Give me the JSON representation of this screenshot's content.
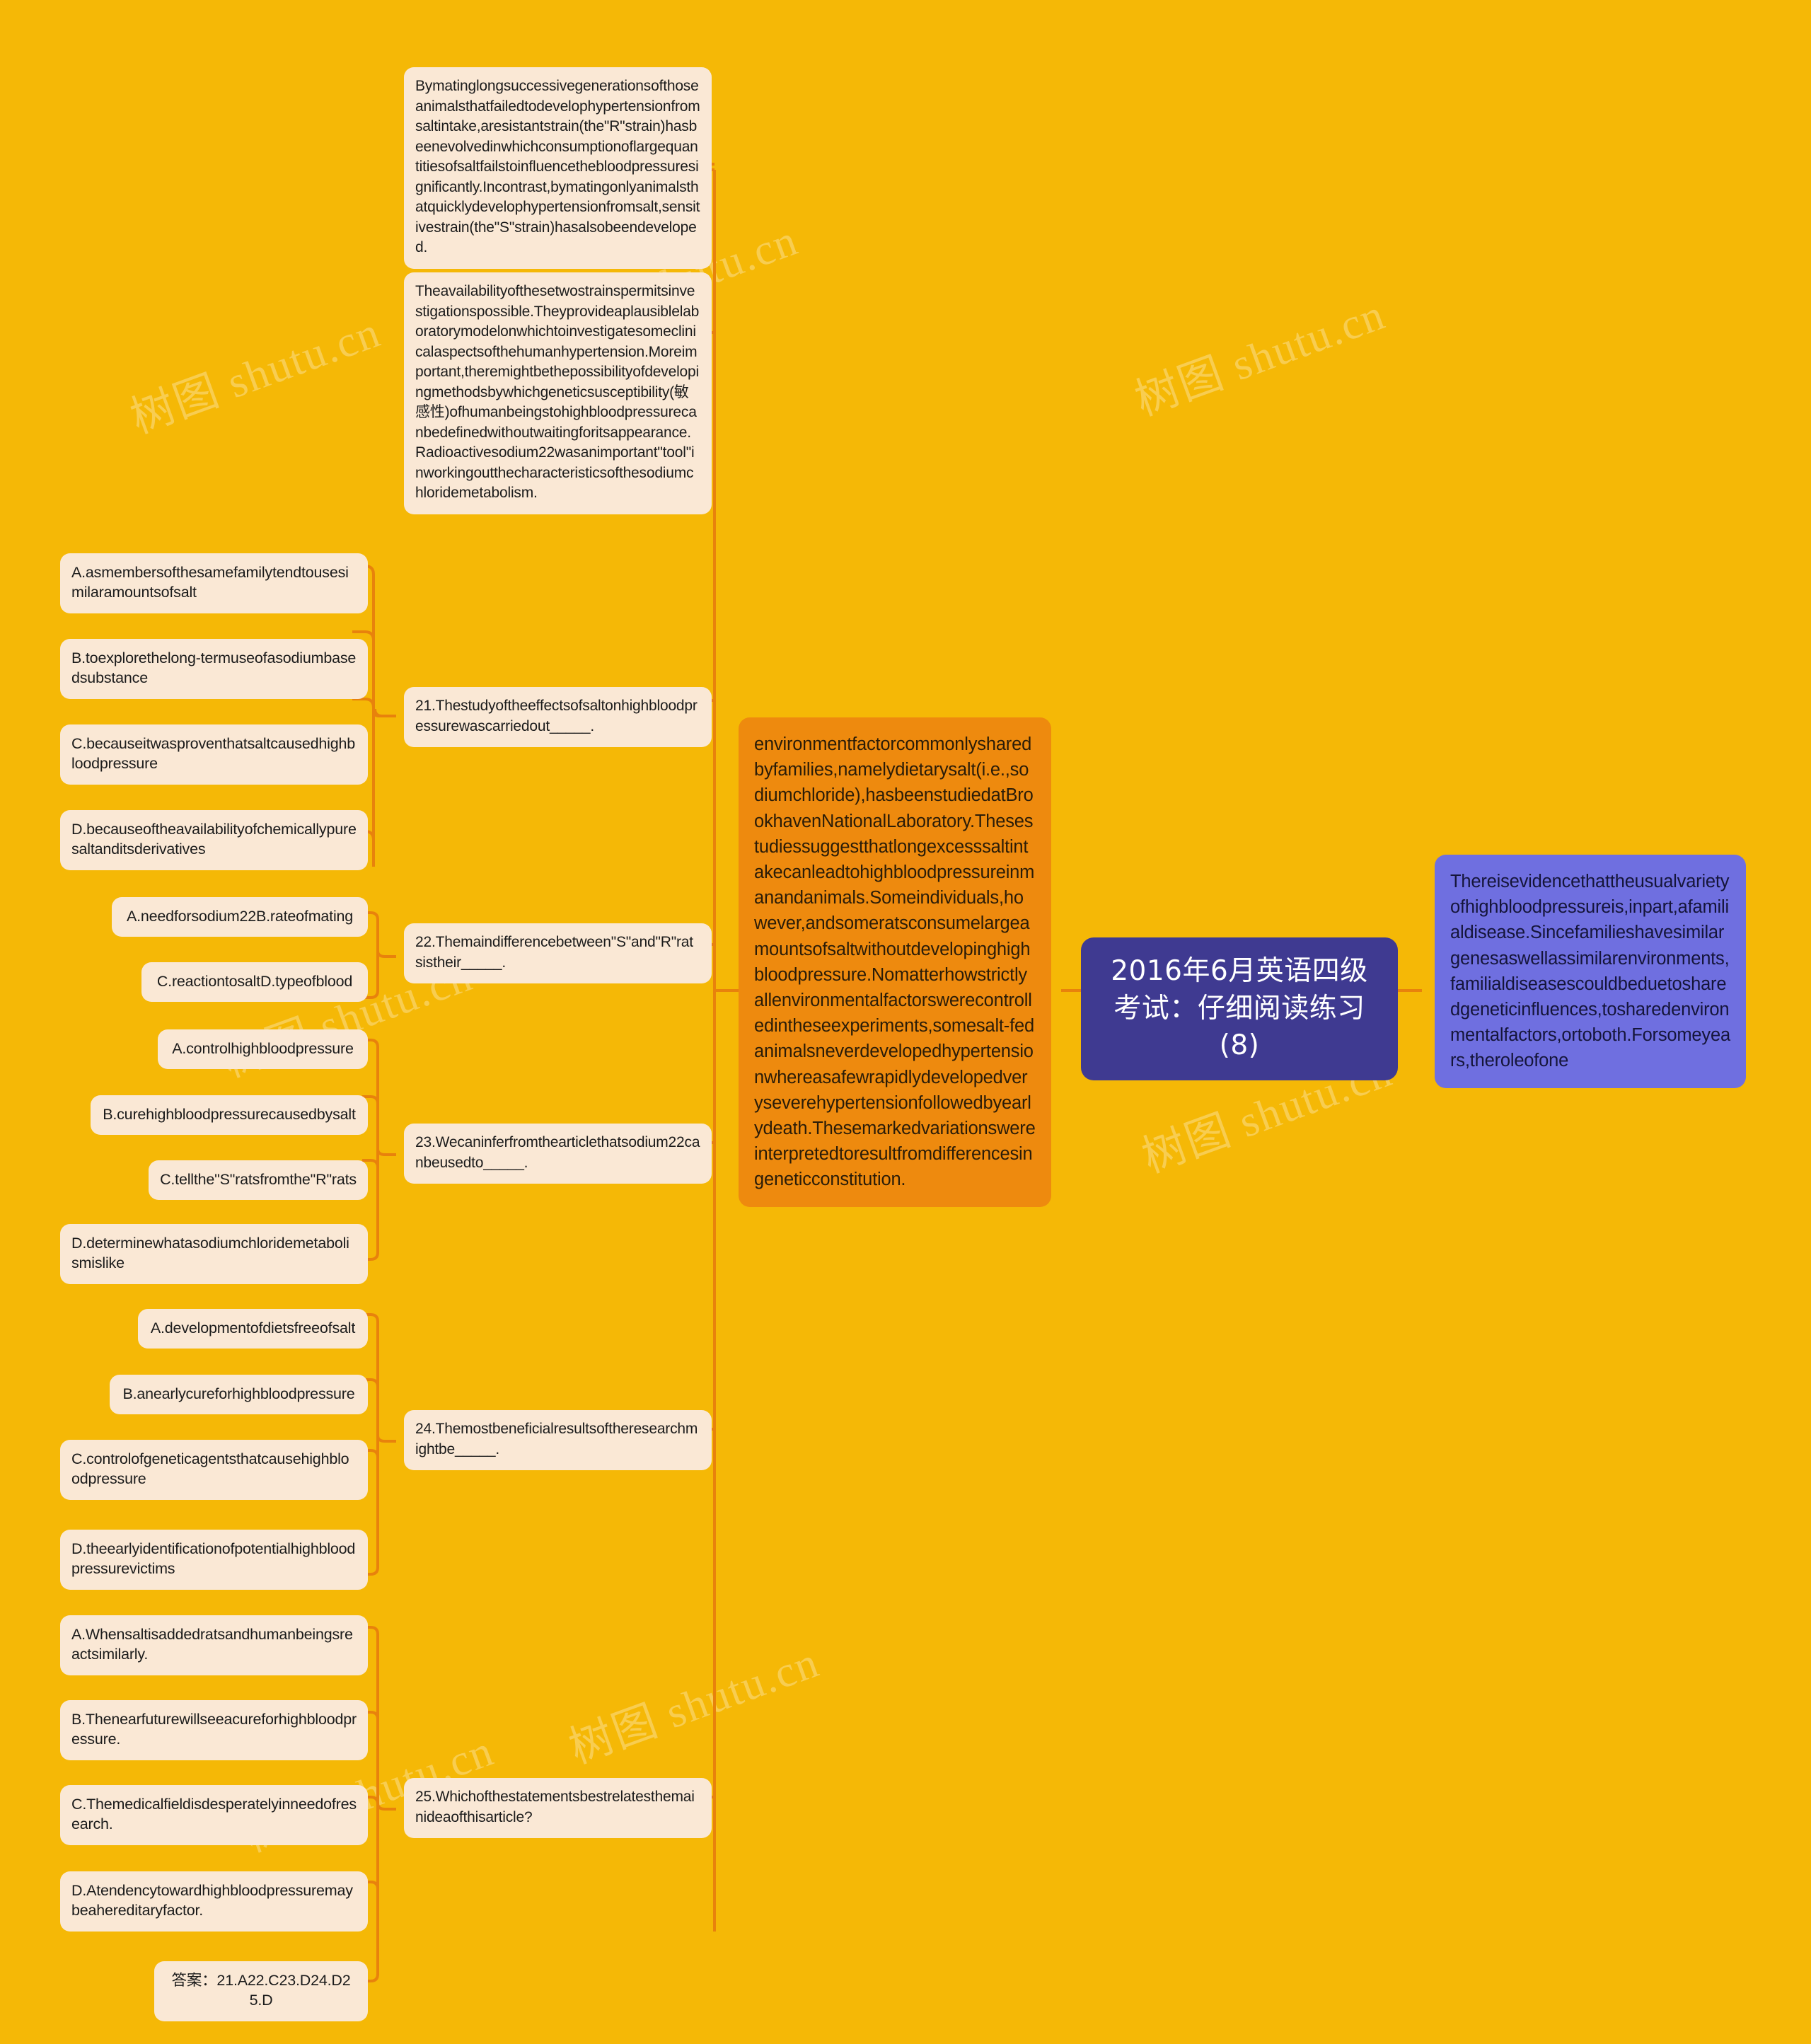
{
  "title": "2016年6月英语四级考试：仔细阅读练习(8)",
  "theme": {
    "background": "#F5B806",
    "node_fill": "#FAE8D5",
    "connector": "#E8820C",
    "center_fill": "#3F3A91",
    "center_text": "#FFFFFF",
    "passage_orange": "#EE8A0E",
    "passage_blue": "#6F6FE0"
  },
  "watermark": "树图 shutu.cn",
  "center": {
    "label": "2016年6月英语四级考试：仔细阅读练习(8)"
  },
  "passages": {
    "blue_right": "Thereisevidencethattheusualvarietyofhighbloodpressureis,inpart,afamilialdisease.Sincefamilieshavesimilargenesaswellassimilarenvironments,familialdiseasescouldbeduetosharedgeneticinfluences,tosharedenvironmentalfactors,ortoboth.Forsomeyears,theroleofone",
    "orange_left": "environmentfactorcommonlysharedbyfamilies,namelydietarysalt(i.e.,sodiumchloride),hasbeenstudiedatBrookhavenNationalLaboratory.Thesestudiessuggestthatlongexcesssaltintakecanleadtohighbloodpressureinmanandanimals.Someindividuals,however,andsomeratsconsumelargeamountsofsaltwithoutdevelopinghighbloodpressure.Nomatterhowstrictlyallenvironmentalfactorswerecontrolledintheseexperiments,somesalt-fedanimalsneverdevelopedhypertensionwhereasafewrapidlydevelopedveryseverehypertensionfollowedbyearlydeath.Thesemarkedvariationswereinterpretedtoresultfromdifferencesingeneticconstitution.",
    "top_first": "Bymatinglongsuccessivegenerationsofthoseanimalsthatfailedtodevelophypertensionfromsaltintake,aresistantstrain(the\"R\"strain)hasbeenevolvedinwhichconsumptionoflargequantitiesofsaltfailstoinfluencethebloodpressuresignificantly.Incontrast,bymatingonlyanimalsthatquicklydevelophypertensionfromsalt,sensitivestrain(the\"S\"strain)hasalsobeendeveloped.",
    "top_second": "Theavailabilityofthesetwostrainspermitsinvestigationspossible.Theyprovideaplausiblelaboratorymodelonwhichtoinvestigatesomeclinicalaspectsofthehumanhypertension.Moreimportant,theremightbethepossibilityofdevelopingmethodsbywhichgeneticsusceptibility(敏感性)ofhumanbeingstohighbloodpressurecanbedefinedwithoutwaitingforitsappearance.Radioactivesodium22wasanimportant\"tool\"inworkingoutthecharacteristicsofthesodiumchloridemetabolism."
  },
  "questions": [
    {
      "id": "q21",
      "stem": "21.Thestudyoftheeffectsofsaltonhighbloodpressurewascarriedout_____.",
      "options": [
        "A.asmembersofthesamefamilytendtousesimilaramountsofsalt",
        "B.toexplorethelong-termuseofasodiumbasedsubstance",
        "C.becauseitwasproventhatsaltcausedhighbloodpressure",
        "D.becauseoftheavailabilityofchemicallypuresaltanditsderivatives"
      ]
    },
    {
      "id": "q22",
      "stem": "22.Themaindifferencebetween\"S\"and\"R\"ratsistheir_____.",
      "options": [
        "A.needforsodium22B.rateofmating",
        "C.reactiontosaltD.typeofblood"
      ]
    },
    {
      "id": "q23",
      "stem": "23.Wecaninferfromthearticlethatsodium22canbeusedto_____.",
      "options": [
        "A.controlhighbloodpressure",
        "B.curehighbloodpressurecausedbysalt",
        "C.tellthe\"S\"ratsfromthe\"R\"rats",
        "D.determinewhatasodiumchloridemetabolismislike"
      ]
    },
    {
      "id": "q24",
      "stem": "24.Themostbeneficialresultsoftheresearchmightbe_____.",
      "options": [
        "A.developmentofdietsfreeofsalt",
        "B.anearlycureforhighbloodpressure",
        "C.controlofgeneticagentsthatcausehighbloodpressure",
        "D.theearlyidentificationofpotentialhighbloodpressurevictims"
      ]
    },
    {
      "id": "q25",
      "stem": "25.Whichofthestatementsbestrelatesthemainideaofthisarticle?",
      "options": [
        "A.Whensaltisaddedratsandhumanbeingsreactsimilarly.",
        "B.Thenearfuturewillseeacureforhighbloodpressure.",
        "C.Themedicalfieldisdesperatelyinneedofresearch.",
        "D.Atendencytowardhighbloodpressuremaybeahereditaryfactor."
      ]
    }
  ],
  "answer_key": "答案：21.A22.C23.D24.D25.D"
}
